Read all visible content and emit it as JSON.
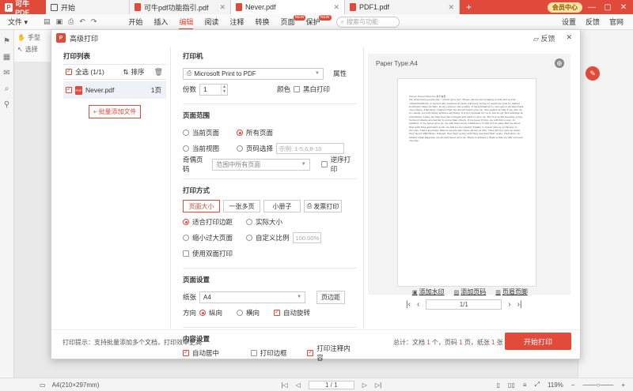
{
  "app": {
    "name": "可牛PDF"
  },
  "tabs": [
    {
      "label": "开始",
      "kind": "home"
    },
    {
      "label": "可牛pdf功能指引.pdf",
      "kind": "pdf"
    },
    {
      "label": "Never.pdf",
      "kind": "pdf",
      "active": true
    },
    {
      "label": "PDF1.pdf",
      "kind": "pdf"
    }
  ],
  "titlebar": {
    "vip_label": "会员中心"
  },
  "menubar": {
    "file": "文件",
    "items": [
      {
        "label": "开始"
      },
      {
        "label": "插入"
      },
      {
        "label": "编辑",
        "active": true
      },
      {
        "label": "阅读"
      },
      {
        "label": "注释"
      },
      {
        "label": "转换"
      },
      {
        "label": "页面",
        "badge": "NEW"
      },
      {
        "label": "保护",
        "badge": "NEW"
      }
    ],
    "search_placeholder": "搜索与功能",
    "right": [
      "设置",
      "反馈",
      "官网"
    ]
  },
  "toolstrip": {
    "hand": "手型",
    "select": "选择"
  },
  "dialog": {
    "title": "高级打印",
    "feedback": "反馈",
    "file_list": {
      "title": "打印列表",
      "select_all": "全选 (1/1)",
      "sort": "排序",
      "files": [
        {
          "name": "Never.pdf",
          "pages": "1页"
        }
      ],
      "add_button": "+ 批量添加文件"
    },
    "printer": {
      "title": "打印机",
      "name": "Microsoft Print to PDF",
      "properties": "属性",
      "copies_label": "份数",
      "copies_value": "1",
      "color_label": "颜色",
      "bw_label": "黑白打印"
    },
    "page_range": {
      "title": "页面范围",
      "current_page": "当前页面",
      "all_pages": "所有页面",
      "current_view": "当前视图",
      "page_select": "页码选择",
      "page_select_placeholder": "示例: 1-5,6,8-10",
      "odd_even_label": "奇偶页码",
      "odd_even_value": "范围中所有页面",
      "reverse_label": "逆序打印"
    },
    "print_mode": {
      "title": "打印方式",
      "buttons": [
        "页面大小",
        "一张多页",
        "小册子",
        "发票打印"
      ],
      "fit": "适合打印边距",
      "actual": "实际大小",
      "shrink": "缩小过大页面",
      "custom_scale": "自定义比例",
      "scale_value": "100.00%",
      "duplex": "使用双面打印"
    },
    "page_setup": {
      "title": "页面设置",
      "paper_label": "纸张",
      "paper_value": "A4",
      "margins_button": "页边距",
      "orientation_label": "方向",
      "portrait": "纵向",
      "landscape": "横向",
      "auto_rotate": "自动旋转"
    },
    "content": {
      "title": "内容设置",
      "auto_center": "自动居中",
      "print_border": "打印边框",
      "print_annotations": "打印注释内容"
    },
    "preview": {
      "paper_type": "Paper Type:A4",
      "doc_title": "Never, Never Give Up    永不言弃",
      "doc_body": "We often hear people say, \" Never give up!\" These can be encouraging words and words ofdetermination. A person who believes in them will keep trying to reach his goal no matter howmany times he fails. In my opinion, the quality of determination to succeed is an important one tohave. Therefore I believe that we should never give up. One reason is that if we give up too easily, we will rarely achieve anything. It is not unusual for us to fail in our first attempt at something. Later, we may feel discouraged and want to give up. But it is worth keeping going. Some problems are harder to solve than others. If we keep trying, we will find a way. In addition, if we never give up, we will have more confidence. It will not be easy. But we know that with time and hard work, we will be successful. Finally, to never give up is the key to success. There are many famous people who have shown us this. They did not give up when they faced difficulties. Instead, they kept going until they reached their goals. Therefore, no matter what happens, we should never give up. There is always a chance that we will succeed one day.",
      "tools": [
        "添加水印",
        "添加页码",
        "页眉页脚"
      ],
      "page_indicator": "1/1"
    },
    "footer": {
      "hint": "打印提示：支持批量添加多个文档，打印效率更高",
      "total_prefix": "总计：文档 ",
      "docs": "1",
      "docs_unit": " 个，页码 ",
      "pages": "1",
      "pages_unit": " 页，纸张 ",
      "sheets": "1",
      "sheets_unit": " 张",
      "start_button": "开始打印"
    }
  },
  "statusbar": {
    "paper": "A4(210×297mm)",
    "page": "1 / 1",
    "zoom": "119%"
  },
  "colors": {
    "accent": "#e04a3a"
  }
}
